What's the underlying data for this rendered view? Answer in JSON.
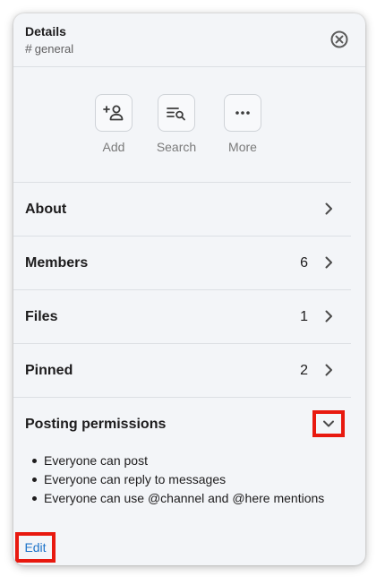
{
  "header": {
    "title": "Details",
    "channel_prefix": "#",
    "channel_name": "general"
  },
  "actions": [
    {
      "label": "Add",
      "icon": "add-person-icon"
    },
    {
      "label": "Search",
      "icon": "search-list-icon"
    },
    {
      "label": "More",
      "icon": "more-dots-icon"
    }
  ],
  "rows": [
    {
      "label": "About",
      "count": ""
    },
    {
      "label": "Members",
      "count": "6"
    },
    {
      "label": "Files",
      "count": "1"
    },
    {
      "label": "Pinned",
      "count": "2"
    }
  ],
  "permissions": {
    "title": "Posting permissions",
    "items": [
      "Everyone can post",
      "Everyone can reply to messages",
      "Everyone can use @channel and @here mentions"
    ],
    "edit_label": "Edit"
  },
  "colors": {
    "panel_bg": "#f3f5f8",
    "highlight": "#e8190f",
    "link": "#1d73c9"
  }
}
